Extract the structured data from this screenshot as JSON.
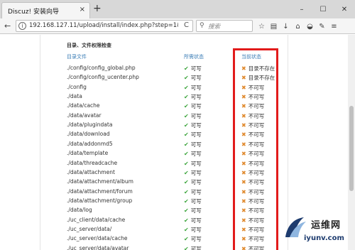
{
  "browser": {
    "tab_title": "Discuz! 安装向导",
    "tab_close": "×",
    "new_tab": "+",
    "window_controls": [
      "–",
      "☐",
      "✕"
    ],
    "url": "192.168.127.11/upload/install/index.php?step=1&u",
    "search_placeholder": "搜索",
    "back": "←",
    "reload": "C",
    "toolbar_icons": [
      "star-icon",
      "reading-list-icon",
      "download-icon",
      "home-icon",
      "pocket-icon",
      "extension-icon",
      "menu-icon"
    ]
  },
  "page": {
    "section_title": "目录、文件权限检查",
    "headers": {
      "path": "目录文件",
      "required": "所需状态",
      "current": "当前状态"
    },
    "rows": [
      {
        "path": "./config/config_global.php",
        "required": "可写",
        "current": "目录不存在"
      },
      {
        "path": "./config/config_ucenter.php",
        "required": "可写",
        "current": "目录不存在"
      },
      {
        "path": "./config",
        "required": "可写",
        "current": "不可写"
      },
      {
        "path": "./data",
        "required": "可写",
        "current": "不可写"
      },
      {
        "path": "./data/cache",
        "required": "可写",
        "current": "不可写"
      },
      {
        "path": "./data/avatar",
        "required": "可写",
        "current": "不可写"
      },
      {
        "path": "./data/plugindata",
        "required": "可写",
        "current": "不可写"
      },
      {
        "path": "./data/download",
        "required": "可写",
        "current": "不可写"
      },
      {
        "path": "./data/addonmd5",
        "required": "可写",
        "current": "不可写"
      },
      {
        "path": "./data/template",
        "required": "可写",
        "current": "不可写"
      },
      {
        "path": "./data/threadcache",
        "required": "可写",
        "current": "不可写"
      },
      {
        "path": "./data/attachment",
        "required": "可写",
        "current": "不可写"
      },
      {
        "path": "./data/attachment/album",
        "required": "可写",
        "current": "不可写"
      },
      {
        "path": "./data/attachment/forum",
        "required": "可写",
        "current": "不可写"
      },
      {
        "path": "./data/attachment/group",
        "required": "可写",
        "current": "不可写"
      },
      {
        "path": "./data/log",
        "required": "可写",
        "current": "不可写"
      },
      {
        "path": "./uc_client/data/cache",
        "required": "可写",
        "current": "不可写"
      },
      {
        "path": "./uc_server/data/",
        "required": "可写",
        "current": "不可写"
      },
      {
        "path": "./uc_server/data/cache",
        "required": "可写",
        "current": "不可写"
      },
      {
        "path": "./uc_server/data/avatar",
        "required": "可写",
        "current": "不可写"
      }
    ]
  },
  "watermark": {
    "cn": "运维网",
    "en": "iyunv.com"
  },
  "colors": {
    "highlight_box": "#e21b1b",
    "check": "#3ea63e",
    "cross": "#e08a2e",
    "header_link": "#3b7db6"
  }
}
